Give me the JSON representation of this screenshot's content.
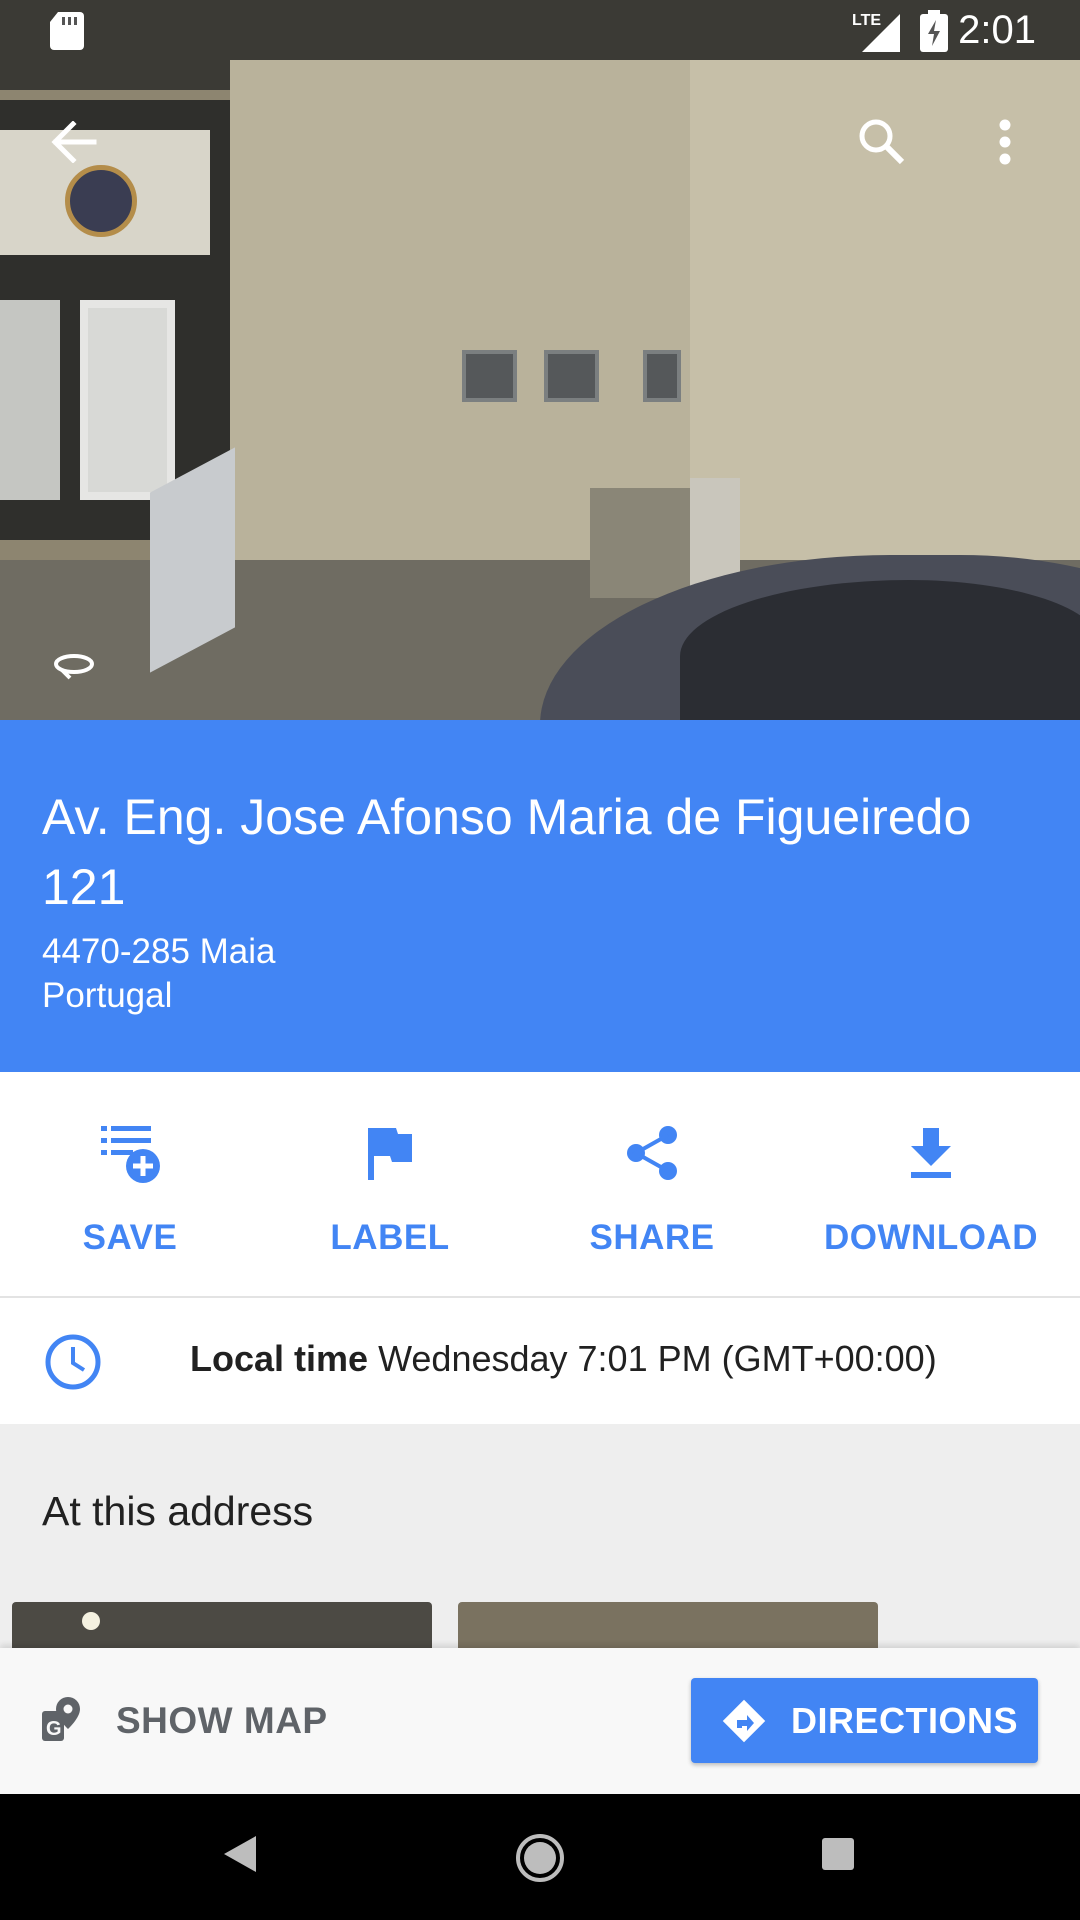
{
  "status_bar": {
    "time": "2:01",
    "network": "LTE",
    "icons": [
      "sd-card-icon",
      "signal-icon",
      "battery-charging-icon"
    ]
  },
  "toolbar": {
    "back_icon": "arrow-back-icon",
    "search_icon": "search-icon",
    "menu_icon": "more-vert-icon"
  },
  "photo": {
    "rotate_icon": "360-view-icon"
  },
  "place": {
    "title": "Av. Eng. Jose Afonso Maria de Figueiredo 121",
    "postal_city": "4470-285 Maia",
    "country": "Portugal"
  },
  "actions": [
    {
      "label": "SAVE",
      "icon": "playlist-add-icon"
    },
    {
      "label": "LABEL",
      "icon": "flag-icon"
    },
    {
      "label": "SHARE",
      "icon": "share-icon"
    },
    {
      "label": "DOWNLOAD",
      "icon": "download-icon"
    }
  ],
  "local_time": {
    "label": "Local time",
    "value": "Wednesday 7:01 PM (GMT+00:00)",
    "icon": "clock-icon"
  },
  "at_address": {
    "heading": "At this address"
  },
  "bottom_bar": {
    "show_map_label": "SHOW MAP",
    "directions_label": "DIRECTIONS"
  },
  "colors": {
    "accent": "#4285f4",
    "section_bg": "#eeeeee"
  }
}
